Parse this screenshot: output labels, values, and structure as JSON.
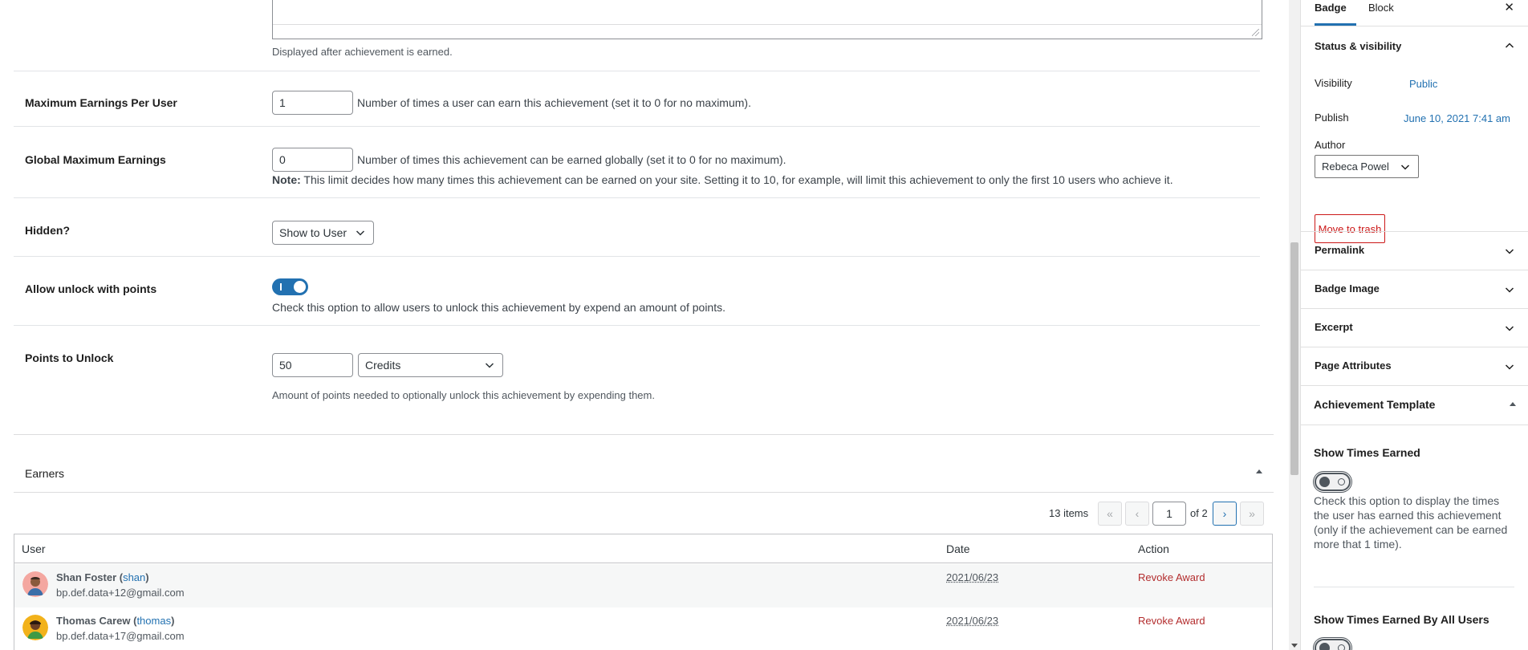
{
  "form": {
    "textarea_description": "Displayed after achievement is earned.",
    "max_earnings_per_user": {
      "label": "Maximum Earnings Per User",
      "value": "1",
      "description": "Number of times a user can earn this achievement (set it to 0 for no maximum)."
    },
    "global_max_earnings": {
      "label": "Global Maximum Earnings",
      "value": "0",
      "description": "Number of times this achievement can be earned globally (set it to 0 for no maximum).",
      "note_label": "Note:",
      "note_text": "This limit decides how many times this achievement can be earned on your site. Setting it to 10, for example, will limit this achievement to only the first 10 users who achieve it."
    },
    "hidden": {
      "label": "Hidden?",
      "selected": "Show to User"
    },
    "allow_unlock_with_points": {
      "label": "Allow unlock with points",
      "enabled": true,
      "description": "Check this option to allow users to unlock this achievement by expend an amount of points."
    },
    "points_to_unlock": {
      "label": "Points to Unlock",
      "value": "50",
      "points_type": "Credits",
      "description": "Amount of points needed to optionally unlock this achievement by expending them."
    }
  },
  "earners": {
    "title": "Earners",
    "items_count": "13 items",
    "first_btn": "«",
    "prev_btn": "‹",
    "next_btn": "›",
    "last_btn": "»",
    "current_page": "1",
    "of_pages": "of 2",
    "columns": {
      "user": "User",
      "date": "Date",
      "action": "Action"
    },
    "rows": [
      {
        "name": "Shan Foster",
        "login": "shan",
        "email": "bp.def.data+12@gmail.com",
        "date": "2021/06/23",
        "action": "Revoke Award"
      },
      {
        "name": "Thomas Carew",
        "login": "thomas",
        "email": "bp.def.data+17@gmail.com",
        "date": "2021/06/23",
        "action": "Revoke Award"
      }
    ]
  },
  "sidebar": {
    "tabs": {
      "badge": "Badge",
      "block": "Block"
    },
    "close": "✕",
    "status": {
      "title": "Status & visibility",
      "visibility_label": "Visibility",
      "visibility_value": "Public",
      "publish_label": "Publish",
      "publish_value": "June 10, 2021 7:41 am",
      "author_label": "Author",
      "author_value": "Rebeca Powel",
      "trash_label": "Move to trash"
    },
    "panels": {
      "permalink": "Permalink",
      "badge_image": "Badge Image",
      "excerpt": "Excerpt",
      "page_attributes": "Page Attributes"
    },
    "achievement_template": {
      "title": "Achievement Template",
      "show_times_earned": {
        "label": "Show Times Earned",
        "enabled": false,
        "description": "Check this option to display the times the user has earned this achievement (only if the achievement can be earned more that 1 time)."
      },
      "show_times_earned_all": {
        "label": "Show Times Earned By All Users"
      }
    }
  }
}
